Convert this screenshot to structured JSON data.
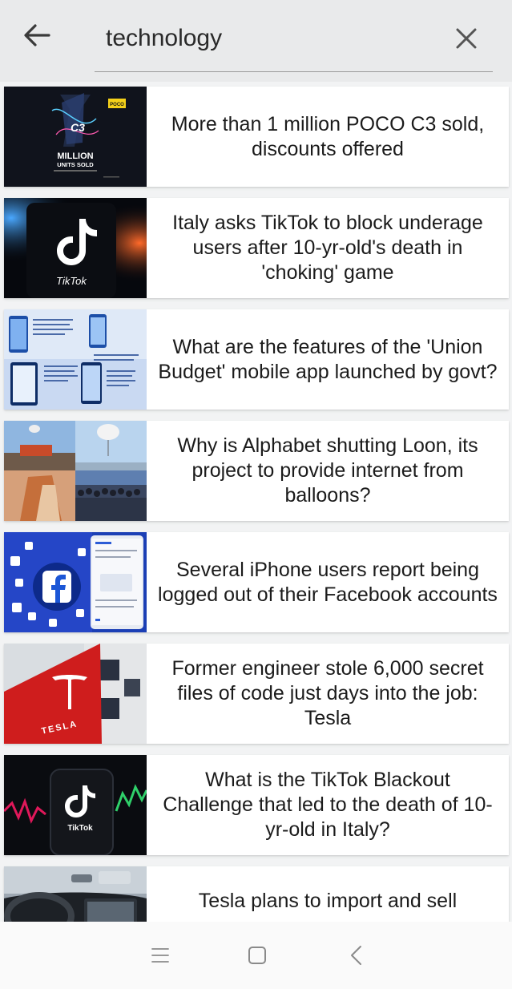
{
  "search": {
    "query": "technology"
  },
  "results": [
    {
      "headline": "More than 1 million POCO C3 sold, discounts offered",
      "thumb_text": [
        "MILLION",
        "UNITS SOLD",
        "POCO",
        "C3"
      ]
    },
    {
      "headline": "Italy asks TikTok to block underage users after 10-yr-old's death in 'choking' game",
      "thumb_text": [
        "TikTok"
      ]
    },
    {
      "headline": "What are the features of the 'Union Budget' mobile app launched by govt?"
    },
    {
      "headline": "Why is Alphabet shutting Loon, its project to provide internet from balloons?"
    },
    {
      "headline": "Several iPhone users report being logged out of their Facebook accounts"
    },
    {
      "headline": "Former engineer stole 6,000 secret files of code just days into the job: Tesla",
      "thumb_text": [
        "TESLA"
      ]
    },
    {
      "headline": "What is the TikTok Blackout Challenge that led to the death of 10-yr-old in Italy?",
      "thumb_text": [
        "TikTok"
      ]
    },
    {
      "headline": "Tesla plans to import and sell"
    }
  ],
  "navbar": {
    "icons": [
      "menu-icon",
      "home-square-icon",
      "back-chevron-icon"
    ]
  },
  "colors": {
    "header_bg": "#e9eaeb",
    "page_bg": "#f2f3f4",
    "card_bg": "#ffffff",
    "text": "#1b1b1b",
    "icon": "#444444"
  }
}
